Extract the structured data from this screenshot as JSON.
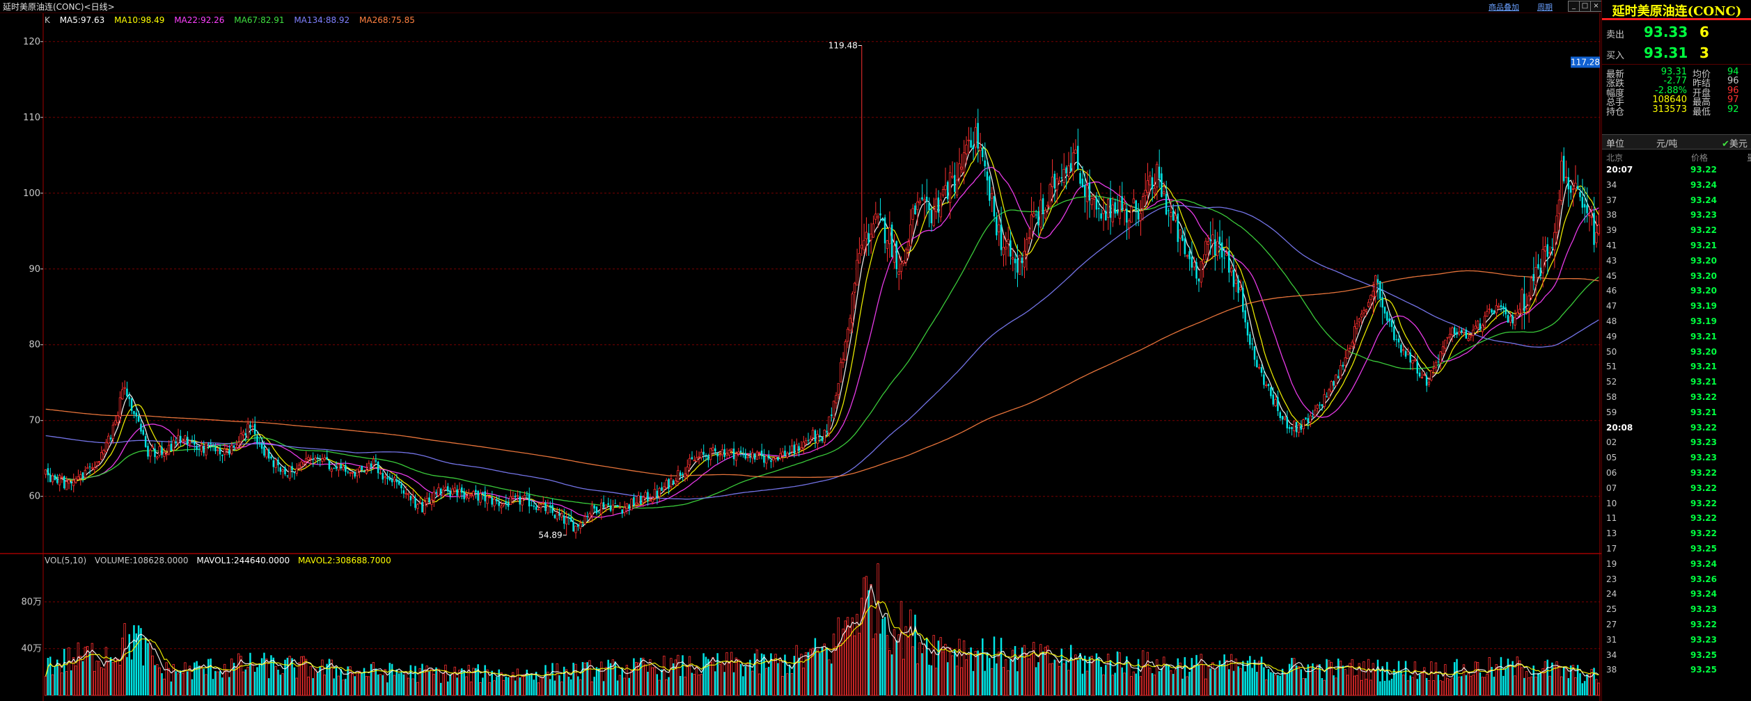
{
  "window": {
    "title": "延时美原油连(CONC)<日线>",
    "links": [
      "商品叠加",
      "周期"
    ],
    "controls": [
      "_",
      "□",
      "×"
    ]
  },
  "indicators": {
    "prefix": "K",
    "ma": [
      {
        "label": "MA5:97.63",
        "color": "#ffffff"
      },
      {
        "label": "MA10:98.49",
        "color": "#ffff00"
      },
      {
        "label": "MA22:92.26",
        "color": "#ff40ff"
      },
      {
        "label": "MA67:82.91",
        "color": "#40e040"
      },
      {
        "label": "MA134:88.92",
        "color": "#8080ff"
      },
      {
        "label": "MA268:75.85",
        "color": "#ff8040"
      }
    ]
  },
  "volume_legend": [
    {
      "label": "VOL(5,10)",
      "color": "#c8c8c8"
    },
    {
      "label": "VOLUME:108628.0000",
      "color": "#c8c8c8"
    },
    {
      "label": "MAVOL1:244640.0000",
      "color": "#ffffff"
    },
    {
      "label": "MAVOL2:308688.7000",
      "color": "#ffff00"
    }
  ],
  "colors": {
    "up": "#ff3030",
    "down": "#00e5e5",
    "grid": "#7a0000",
    "current_price_tag": "#1060d0"
  },
  "chart_data": {
    "type": "candlestick",
    "price_axis": {
      "ticks": [
        "120",
        "110",
        "100",
        "90",
        "80",
        "70",
        "60"
      ],
      "ylim": [
        53,
        122
      ]
    },
    "volume_axis": {
      "ticks": [
        "80万",
        "40万"
      ],
      "ylim": [
        0,
        1100000
      ]
    },
    "annotations": {
      "high": "119.48",
      "low": "54.89",
      "current": "117.28"
    },
    "anchors": [
      [
        0,
        62.8
      ],
      [
        10,
        61.5
      ],
      [
        20,
        63.5
      ],
      [
        28,
        68
      ],
      [
        34,
        74.5
      ],
      [
        38,
        71
      ],
      [
        44,
        66
      ],
      [
        50,
        65.8
      ],
      [
        58,
        67.5
      ],
      [
        66,
        66.5
      ],
      [
        76,
        66
      ],
      [
        82,
        66.5
      ],
      [
        88,
        69.5
      ],
      [
        94,
        66
      ],
      [
        102,
        63
      ],
      [
        110,
        64
      ],
      [
        118,
        65
      ],
      [
        126,
        63.5
      ],
      [
        134,
        63
      ],
      [
        140,
        64.5
      ],
      [
        146,
        62.5
      ],
      [
        150,
        62
      ],
      [
        156,
        60
      ],
      [
        162,
        58
      ],
      [
        168,
        61
      ],
      [
        176,
        60.5
      ],
      [
        186,
        60
      ],
      [
        196,
        59
      ],
      [
        206,
        59.5
      ],
      [
        214,
        58.5
      ],
      [
        222,
        57
      ],
      [
        228,
        56
      ],
      [
        234,
        58
      ],
      [
        240,
        59
      ],
      [
        248,
        58.5
      ],
      [
        256,
        59.5
      ],
      [
        264,
        60.5
      ],
      [
        272,
        63
      ],
      [
        280,
        65
      ],
      [
        290,
        66
      ],
      [
        300,
        65.5
      ],
      [
        310,
        65
      ],
      [
        322,
        66
      ],
      [
        330,
        68
      ],
      [
        334,
        67
      ],
      [
        338,
        71
      ],
      [
        344,
        80
      ],
      [
        350,
        92
      ],
      [
        356,
        96
      ],
      [
        362,
        95
      ],
      [
        368,
        90
      ],
      [
        374,
        98
      ],
      [
        380,
        97
      ],
      [
        386,
        100
      ],
      [
        392,
        102
      ],
      [
        396,
        105
      ],
      [
        400,
        108
      ],
      [
        404,
        102
      ],
      [
        408,
        97
      ],
      [
        412,
        93
      ],
      [
        418,
        90
      ],
      [
        424,
        96
      ],
      [
        430,
        98
      ],
      [
        436,
        103
      ],
      [
        442,
        105
      ],
      [
        448,
        100
      ],
      [
        454,
        96
      ],
      [
        460,
        99
      ],
      [
        466,
        97
      ],
      [
        472,
        99
      ],
      [
        478,
        102
      ],
      [
        484,
        97
      ],
      [
        490,
        92
      ],
      [
        496,
        90
      ],
      [
        502,
        94
      ],
      [
        508,
        92
      ],
      [
        514,
        86
      ],
      [
        520,
        78
      ],
      [
        526,
        74
      ],
      [
        532,
        70
      ],
      [
        538,
        69
      ],
      [
        544,
        70
      ],
      [
        550,
        73
      ],
      [
        556,
        76
      ],
      [
        562,
        81
      ],
      [
        568,
        85
      ],
      [
        572,
        89
      ],
      [
        576,
        84
      ],
      [
        582,
        80
      ],
      [
        588,
        78
      ],
      [
        594,
        75
      ],
      [
        600,
        79
      ],
      [
        606,
        82
      ],
      [
        612,
        81
      ],
      [
        618,
        83
      ],
      [
        624,
        85
      ],
      [
        630,
        83
      ],
      [
        636,
        86
      ],
      [
        642,
        90
      ],
      [
        648,
        94
      ],
      [
        652,
        103
      ],
      [
        656,
        101
      ],
      [
        660,
        98
      ],
      [
        664,
        96
      ],
      [
        668,
        94
      ]
    ],
    "candle_count": 669,
    "volume_profile": [
      [
        0,
        260000
      ],
      [
        30,
        380000
      ],
      [
        38,
        500000
      ],
      [
        50,
        200000
      ],
      [
        90,
        260000
      ],
      [
        140,
        200000
      ],
      [
        200,
        180000
      ],
      [
        270,
        240000
      ],
      [
        320,
        280000
      ],
      [
        338,
        400000
      ],
      [
        350,
        760000
      ],
      [
        356,
        860000
      ],
      [
        362,
        640000
      ],
      [
        380,
        430000
      ],
      [
        420,
        320000
      ],
      [
        480,
        260000
      ],
      [
        540,
        230000
      ],
      [
        600,
        210000
      ],
      [
        640,
        240000
      ],
      [
        668,
        160000
      ]
    ]
  },
  "quote_panel": {
    "title": "延时美原油连(CONC)",
    "ask": {
      "label": "卖出",
      "price": "93.33",
      "qty": "6"
    },
    "bid": {
      "label": "买入",
      "price": "93.31",
      "qty": "3"
    },
    "stats": [
      {
        "k": "最新",
        "v": "93.31",
        "vc": "#00ff40",
        "k2": "均价",
        "v2": "94",
        "v2c": "#00ff40"
      },
      {
        "k": "涨跌",
        "v": "-2.77",
        "vc": "#00ff40",
        "k2": "昨结",
        "v2": "96",
        "v2c": "#c8c8c8"
      },
      {
        "k": "幅度",
        "v": "-2.88%",
        "vc": "#00ff40",
        "k2": "开盘",
        "v2": "96",
        "v2c": "#ff3030"
      },
      {
        "k": "总手",
        "v": "108640",
        "vc": "#ffff00",
        "k2": "最高",
        "v2": "97",
        "v2c": "#ff3030"
      },
      {
        "k": "持仓",
        "v": "313573",
        "vc": "#ffff00",
        "k2": "最低",
        "v2": "92",
        "v2c": "#00ff40"
      }
    ],
    "unit": {
      "label": "单位",
      "value": "元/吨",
      "checkbox": "美元"
    },
    "ticks_header": {
      "time": "北京",
      "price": "价格",
      "vol": "量"
    },
    "ticks": [
      {
        "t": "20:07",
        "p": "93.22",
        "bold": true
      },
      {
        "t": "34",
        "p": "93.24"
      },
      {
        "t": "37",
        "p": "93.24"
      },
      {
        "t": "38",
        "p": "93.23"
      },
      {
        "t": "39",
        "p": "93.22"
      },
      {
        "t": "41",
        "p": "93.21"
      },
      {
        "t": "43",
        "p": "93.20"
      },
      {
        "t": "45",
        "p": "93.20"
      },
      {
        "t": "46",
        "p": "93.20"
      },
      {
        "t": "47",
        "p": "93.19"
      },
      {
        "t": "48",
        "p": "93.19"
      },
      {
        "t": "49",
        "p": "93.21"
      },
      {
        "t": "50",
        "p": "93.20"
      },
      {
        "t": "51",
        "p": "93.21"
      },
      {
        "t": "52",
        "p": "93.21"
      },
      {
        "t": "58",
        "p": "93.22"
      },
      {
        "t": "59",
        "p": "93.21"
      },
      {
        "t": "20:08",
        "p": "93.22",
        "bold": true
      },
      {
        "t": "02",
        "p": "93.23"
      },
      {
        "t": "05",
        "p": "93.23"
      },
      {
        "t": "06",
        "p": "93.22"
      },
      {
        "t": "07",
        "p": "93.22"
      },
      {
        "t": "10",
        "p": "93.22"
      },
      {
        "t": "11",
        "p": "93.22"
      },
      {
        "t": "13",
        "p": "93.22"
      },
      {
        "t": "17",
        "p": "93.25"
      },
      {
        "t": "19",
        "p": "93.24"
      },
      {
        "t": "23",
        "p": "93.26"
      },
      {
        "t": "24",
        "p": "93.24"
      },
      {
        "t": "25",
        "p": "93.23"
      },
      {
        "t": "27",
        "p": "93.22"
      },
      {
        "t": "31",
        "p": "93.23"
      },
      {
        "t": "34",
        "p": "93.25"
      },
      {
        "t": "38",
        "p": "93.25"
      }
    ]
  }
}
